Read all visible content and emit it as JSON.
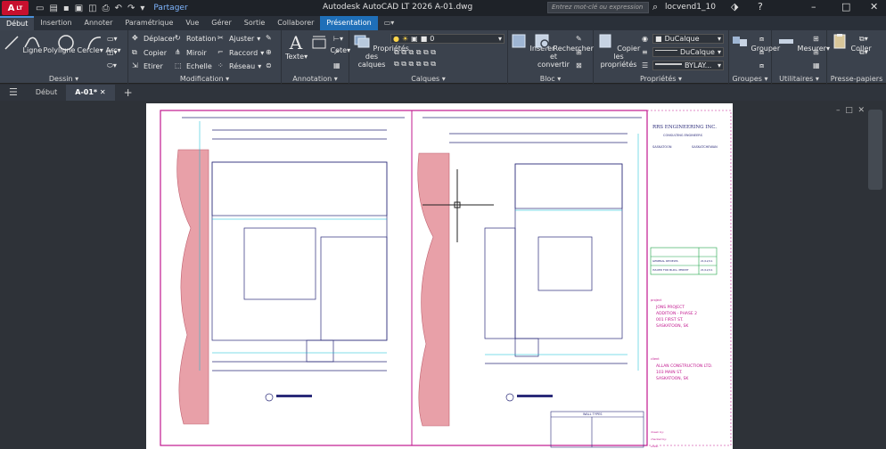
{
  "titlebar": {
    "logo": "A",
    "logo_sub": "LT",
    "share": "Partager",
    "app_title": "Autodesk AutoCAD LT 2026    A-01.dwg",
    "search_placeholder": "Entrez mot-clé ou expression",
    "user": "locvend1_10"
  },
  "ribbon_tabs": [
    "Début",
    "Insertion",
    "Annoter",
    "Paramétrique",
    "Vue",
    "Gérer",
    "Sortie",
    "Collaborer",
    "Présentation"
  ],
  "ribbon": {
    "dessin": {
      "label": "Dessin",
      "ligne": "Ligne",
      "polyligne": "Polyligne",
      "cercle": "Cercle",
      "arc": "Arc"
    },
    "modification": {
      "label": "Modification",
      "deplacer": "Déplacer",
      "rotation": "Rotation",
      "ajuster": "Ajuster",
      "copier": "Copier",
      "miroir": "Miroir",
      "raccord": "Raccord",
      "etirer": "Etirer",
      "echelle": "Echelle",
      "reseau": "Réseau"
    },
    "annotation": {
      "label": "Annotation",
      "texte": "Texte",
      "cote": "Cote"
    },
    "calques": {
      "label": "Calques",
      "proprietes": "Propriétés\ndes calques",
      "current_layer": "0"
    },
    "bloc": {
      "label": "Bloc",
      "inserer": "Insérer",
      "rechercher": "Rechercher et\nconvertir"
    },
    "proprietes": {
      "label": "Propriétés",
      "copier": "Copier\nles propriétés",
      "color": "DuCalque",
      "linetype": "DuCalque",
      "lineweight": "BYLAY..."
    },
    "groupes": {
      "label": "Groupes",
      "grouper": "Grouper"
    },
    "utilitaires": {
      "label": "Utilitaires",
      "mesurer": "Mesurer"
    },
    "presse": {
      "label": "Presse-papiers",
      "coller": "Coller"
    }
  },
  "filetabs": {
    "debut": "Début",
    "active": "A-01*"
  },
  "drawing": {
    "company": "RRS ENGINEERING INC.",
    "company_sub": "CONSULTING ENGINEERS",
    "city": "SASKATOON",
    "province": "SASKATCHEWAN",
    "revisions": [
      "GENERAL REVIEWS",
      "ISSUED FOR BLDG. PERMIT"
    ],
    "rev_dates": [
      "21/12/11",
      "21/12/11"
    ],
    "project_label": "project",
    "project_lines": [
      "JONS PROJECT",
      "ADDITION - PHASE 2",
      "001 FIRST ST.",
      "SASKATOON, SK"
    ],
    "client_label": "client",
    "client_lines": [
      "ALLAN CONSTRUCTION LTD.",
      "103 MAIN ST.",
      "SASKATOON, SK"
    ],
    "wall_types": "WALL TYPES",
    "drawn_by": "drawn by:",
    "checked_by": "checked by:",
    "scale": "scale:"
  }
}
